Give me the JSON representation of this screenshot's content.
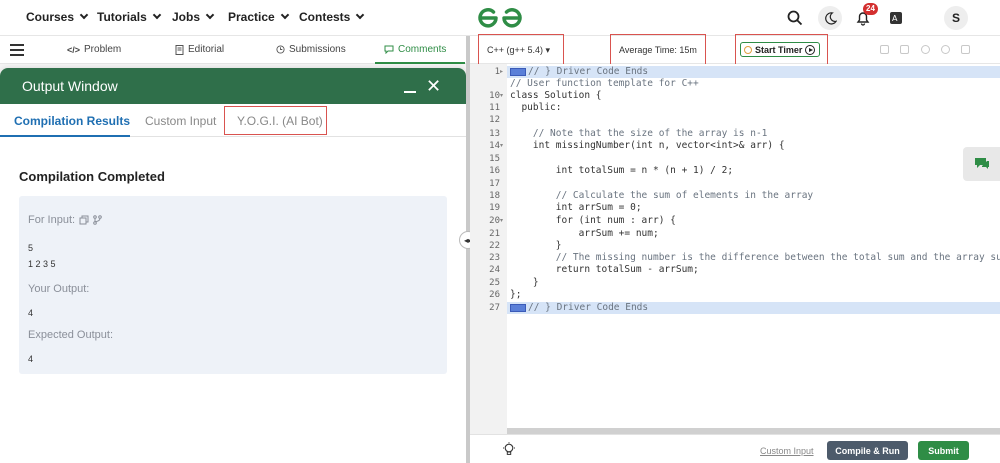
{
  "nav": {
    "items": [
      {
        "label": "Courses"
      },
      {
        "label": "Tutorials"
      },
      {
        "label": "Jobs"
      },
      {
        "label": "Practice"
      },
      {
        "label": "Contests"
      }
    ],
    "logo_icon": "geeksforgeeks-logo",
    "notification_count": "24",
    "avatar_letter": "S"
  },
  "problem_tabs": {
    "items": [
      {
        "label": "Problem",
        "icon": "code-icon"
      },
      {
        "label": "Editorial",
        "icon": "document-icon"
      },
      {
        "label": "Submissions",
        "icon": "clock-icon"
      },
      {
        "label": "Comments",
        "icon": "comment-icon"
      }
    ],
    "active": "Comments"
  },
  "output_window": {
    "title": "Output Window",
    "tabs": [
      {
        "label": "Compilation Results"
      },
      {
        "label": "Custom Input"
      },
      {
        "label": "Y.O.G.I. (AI Bot)"
      }
    ],
    "active_tab": "Compilation Results",
    "status": "Compilation Completed",
    "results": {
      "for_input_label": "For Input:",
      "input_lines": [
        "5",
        "1 2 3 5"
      ],
      "your_output_label": "Your Output:",
      "your_output": "4",
      "expected_output_label": "Expected Output:",
      "expected_output": "4"
    }
  },
  "editor": {
    "language": "C++ (g++ 5.4)",
    "average_time": "Average Time: 15m",
    "start_timer_label": "Start Timer",
    "line_numbers": [
      "1",
      "10",
      "11",
      "12",
      "13",
      "14",
      "15",
      "16",
      "17",
      "18",
      "19",
      "20",
      "21",
      "22",
      "23",
      "24",
      "25",
      "26",
      "27"
    ],
    "code_lines": [
      "// } Driver Code Ends",
      "// User function template for C++",
      "class Solution {",
      "  public:",
      "",
      "    // Note that the size of the array is n-1",
      "    int missingNumber(int n, vector<int>& arr) {",
      "",
      "        int totalSum = n * (n + 1) / 2;",
      "",
      "        // Calculate the sum of elements in the array",
      "        int arrSum = 0;",
      "        for (int num : arr) {",
      "            arrSum += num;",
      "        }",
      "        // The missing number is the difference between the total sum and the array sum",
      "        return totalSum - arrSum;",
      "    }",
      "};",
      "// } Driver Code Ends"
    ]
  },
  "footer": {
    "custom_input_label": "Custom Input",
    "compile_run_label": "Compile & Run",
    "submit_label": "Submit"
  },
  "colors": {
    "brand_green": "#2f8d46",
    "output_header": "#2f6f4a",
    "active_tab_blue": "#1f6fb2",
    "highlight": "#d9534f"
  }
}
